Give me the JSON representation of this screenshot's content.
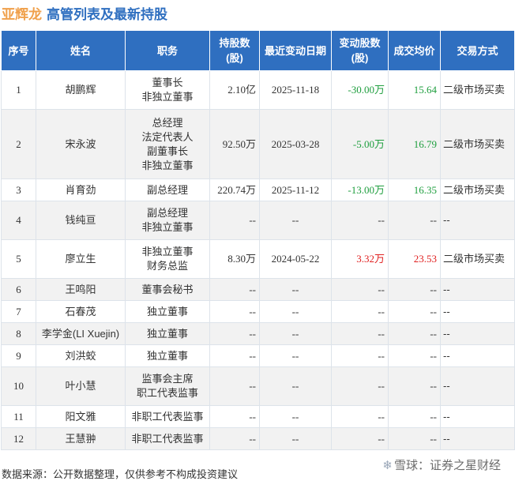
{
  "title": {
    "company": "亚辉龙",
    "rest": "高管列表及最新持股"
  },
  "columns": [
    "序号",
    "姓名",
    "职务",
    "持股数\n(股)",
    "最近变动日期",
    "变动股数\n(股)",
    "成交均价",
    "交易方式"
  ],
  "rows": [
    {
      "idx": "1",
      "name": "胡鹏辉",
      "roles": [
        "董事长",
        "非独立董事"
      ],
      "shares": "2.10亿",
      "date": "2025-11-18",
      "change": "-30.00万",
      "change_dir": "neg",
      "price": "15.64",
      "method": "二级市场买卖"
    },
    {
      "idx": "2",
      "name": "宋永波",
      "roles": [
        "总经理",
        "法定代表人",
        "副董事长",
        "非独立董事"
      ],
      "shares": "92.50万",
      "date": "2025-03-28",
      "change": "-5.00万",
      "change_dir": "neg",
      "price": "16.79",
      "method": "二级市场买卖"
    },
    {
      "idx": "3",
      "name": "肖育劲",
      "roles": [
        "副总经理"
      ],
      "shares": "220.74万",
      "date": "2025-11-12",
      "change": "-13.00万",
      "change_dir": "neg",
      "price": "16.35",
      "method": "二级市场买卖"
    },
    {
      "idx": "4",
      "name": "钱纯亘",
      "roles": [
        "副总经理",
        "非独立董事"
      ],
      "shares": "--",
      "date": "--",
      "change": "--",
      "change_dir": "none",
      "price": "--",
      "method": "--"
    },
    {
      "idx": "5",
      "name": "廖立生",
      "roles": [
        "非独立董事",
        "财务总监"
      ],
      "shares": "8.30万",
      "date": "2024-05-22",
      "change": "3.32万",
      "change_dir": "pos",
      "price": "23.53",
      "method": "二级市场买卖"
    },
    {
      "idx": "6",
      "name": "王鸣阳",
      "roles": [
        "董事会秘书"
      ],
      "shares": "--",
      "date": "--",
      "change": "--",
      "change_dir": "none",
      "price": "--",
      "method": "--"
    },
    {
      "idx": "7",
      "name": "石春茂",
      "roles": [
        "独立董事"
      ],
      "shares": "--",
      "date": "--",
      "change": "--",
      "change_dir": "none",
      "price": "--",
      "method": "--"
    },
    {
      "idx": "8",
      "name": "李学金(LI Xuejin)",
      "roles": [
        "独立董事"
      ],
      "shares": "--",
      "date": "--",
      "change": "--",
      "change_dir": "none",
      "price": "--",
      "method": "--"
    },
    {
      "idx": "9",
      "name": "刘洪蛟",
      "roles": [
        "独立董事"
      ],
      "shares": "--",
      "date": "--",
      "change": "--",
      "change_dir": "none",
      "price": "--",
      "method": "--"
    },
    {
      "idx": "10",
      "name": "叶小慧",
      "roles": [
        "监事会主席",
        "职工代表监事"
      ],
      "shares": "--",
      "date": "--",
      "change": "--",
      "change_dir": "none",
      "price": "--",
      "method": "--"
    },
    {
      "idx": "11",
      "name": "阳文雅",
      "roles": [
        "非职工代表监事"
      ],
      "shares": "--",
      "date": "--",
      "change": "--",
      "change_dir": "none",
      "price": "--",
      "method": "--"
    },
    {
      "idx": "12",
      "name": "王慧翀",
      "roles": [
        "非职工代表监事"
      ],
      "shares": "--",
      "date": "--",
      "change": "--",
      "change_dir": "none",
      "price": "--",
      "method": "--"
    }
  ],
  "footer": "数据来源：公开数据整理，仅供参考不构成投资建议",
  "logo": {
    "icon": "snowball-icon",
    "text": "雪球：证券之星财经"
  },
  "watermark": "证券之星",
  "colors": {
    "header_bg": "#2f6fc0",
    "title_blue": "#2f6fc0",
    "title_orange": "#f0a04b",
    "negative": "#1e9e3e",
    "positive": "#e02020"
  }
}
